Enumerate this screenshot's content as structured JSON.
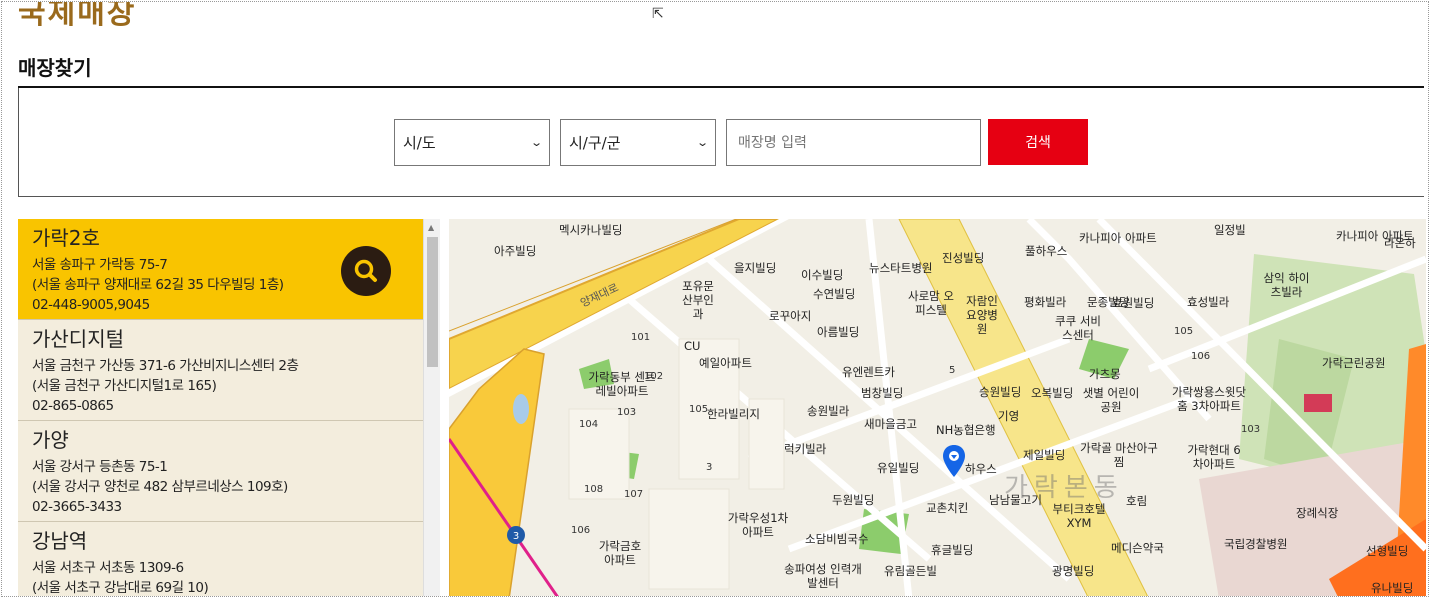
{
  "brand": {
    "text": "국제매장"
  },
  "page": {
    "title": "매장찾기"
  },
  "search": {
    "sido_value": "시/도",
    "gugun_value": "시/구/군",
    "name_placeholder": "매장명 입력",
    "button_label": "검색"
  },
  "colors": {
    "accent": "#e60012",
    "highlight": "#f9c400",
    "list_bg": "#f3eddd"
  },
  "stores": [
    {
      "name": "가락2호",
      "address": "서울 송파구 가락동 75-7",
      "road": "(서울 송파구 양재대로 62길 35 다우빌딩 1층)",
      "phone": "02-448-9005,9045",
      "active": true
    },
    {
      "name": "가산디지털",
      "address": "서울 금천구 가산동 371-6 가산비지니스센터 2층",
      "road": "(서울 금천구 가산디지털1로 165)",
      "phone": "02-865-0865"
    },
    {
      "name": "가양",
      "address": "서울 강서구 등촌동 75-1",
      "road": "(서울 강서구 양천로 482 삼부르네상스 109호)",
      "phone": "02-3665-3433"
    },
    {
      "name": "강남역",
      "address": "서울 서초구 서초동 1309-6",
      "road": "(서울 서초구 강남대로 69길 10)",
      "phone": ""
    }
  ],
  "map": {
    "district": "가락본동",
    "road_names": [
      "양재대로"
    ],
    "labels": [
      "멕시카나빌딩",
      "아주빌딩",
      "일정빌",
      "카나피아",
      "카나피아 아파트",
      "라온하",
      "을지빌딩",
      "뉴스타트병원",
      "진성빌딩",
      "풀하우스",
      "카나피아 아파트",
      "포유문 산부인과",
      "이수빌딩",
      "수연빌딩",
      "사로맘 오피스텔",
      "자람인 요양병원",
      "평화빌라",
      "문종빌딩",
      "효성빌라",
      "삼익 하이츠빌라",
      "로꾸아지",
      "아름빌딩",
      "쿠쿠 서비스센터",
      "효원빌딩",
      "CU",
      "예일아파트",
      "유엔렌트카",
      "범창빌딩",
      "승원빌딩",
      "오복빌딩",
      "가츠몽",
      "샛별 어린이공원",
      "가락쌍용스윗닷홈 3차아파트",
      "가락근린공원",
      "가락동부 센트레빌아파트",
      "한라빌리지",
      "송원빌라",
      "새마을금고",
      "NH농협은행",
      "기영",
      "럭키빌라",
      "가락골 마산아구찜",
      "가락현대 6차아파트",
      "유일빌딩",
      "하우스",
      "제일빌딩",
      "두원빌딩",
      "교촌치킨",
      "남남물고기",
      "부티크호텔 XYM",
      "호림",
      "장례식장",
      "가락우성1차 아파트",
      "소담비빔국수",
      "휴글빌딩",
      "메디슨약국",
      "국립경찰병원",
      "선형빌딩",
      "가락금호 아파트",
      "송파여성 인력개발센터",
      "유림골든빌",
      "광명빌딩",
      "유나빌딩"
    ]
  }
}
